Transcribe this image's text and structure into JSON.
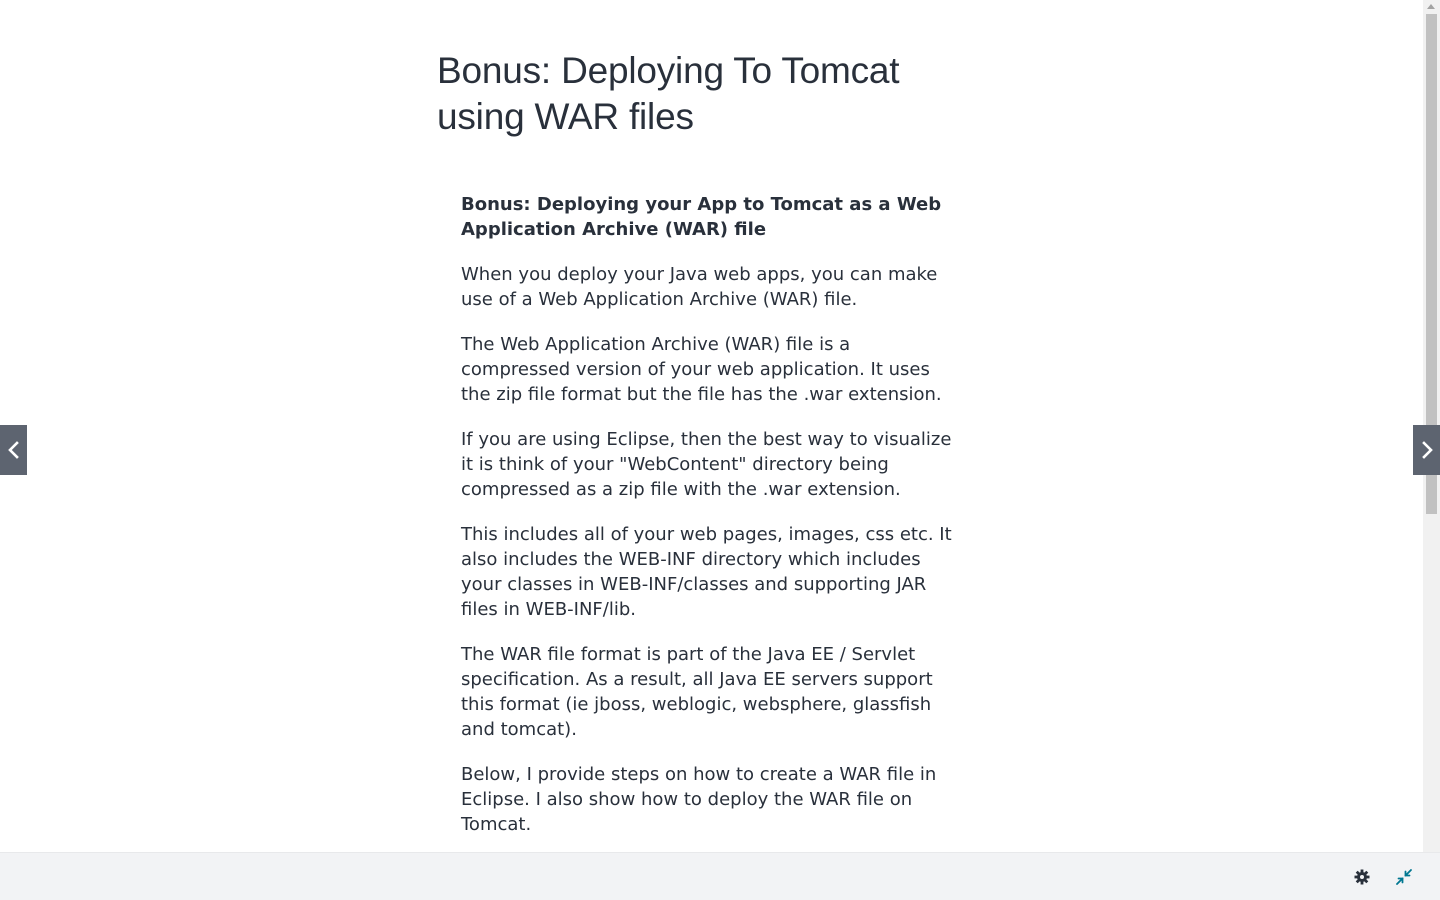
{
  "lecture": {
    "title": "Bonus: Deploying To Tomcat using WAR files"
  },
  "article": {
    "heading": "Bonus: Deploying your App to Tomcat as a Web Application Archive (WAR) file",
    "paragraphs": [
      "When you deploy your Java web apps, you can make use of a Web Application Archive (WAR) file.",
      "The Web Application Archive (WAR) file is a compressed version of your web application. It uses the zip file format but the file has the .war extension.",
      "If you are using Eclipse, then the best way to visualize it is think of your \"WebContent\" directory being compressed as a zip file with the .war extension.",
      "This includes all of your web pages, images, css etc. It also includes the WEB-INF directory which includes your classes in WEB-INF/classes and supporting JAR files in WEB-INF/lib.",
      "The WAR file format is part of the Java EE / Servlet specification. As a result, all Java EE servers support this format (ie jboss, weblogic, websphere, glassfish and tomcat).",
      "Below, I provide steps on how to create a WAR file in Eclipse. I also show how to deploy the WAR file on Tomcat.",
      "---"
    ]
  },
  "navigation": {
    "prev_icon": "chevron-left-icon",
    "next_icon": "chevron-right-icon"
  },
  "footer": {
    "settings_icon": "gear-icon",
    "exit_fullscreen_icon": "compress-icon"
  },
  "colors": {
    "text": "#29303b",
    "nav_button": "#5d6470",
    "footer_bg": "#f2f3f5",
    "accent": "#007791"
  }
}
